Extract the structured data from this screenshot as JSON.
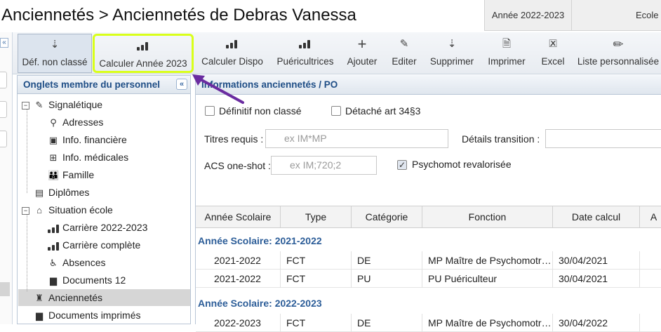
{
  "header": {
    "title": "Anciennetés > Anciennetés de Debras Vanessa",
    "year_tab": "Année 2022-2023",
    "school_tab": "Ecole"
  },
  "toolbar": {
    "buttons": [
      {
        "label": "Déf. non classé",
        "icon": "sort-icon"
      },
      {
        "label": "Calculer Année 2023",
        "icon": "bar-chart-icon"
      },
      {
        "label": "Calculer Dispo",
        "icon": "bar-chart-icon"
      },
      {
        "label": "Puéricultrices",
        "icon": "bar-chart-icon"
      },
      {
        "label": "Ajouter",
        "icon": "plus-icon"
      },
      {
        "label": "Editer",
        "icon": "edit-icon"
      },
      {
        "label": "Supprimer",
        "icon": "sort-icon"
      },
      {
        "label": "Imprimer",
        "icon": "document-icon"
      },
      {
        "label": "Excel",
        "icon": "excel-icon"
      },
      {
        "label": "Liste personnalisée",
        "icon": "pencil-icon"
      }
    ]
  },
  "sidebar": {
    "title": "Onglets membre du personnel",
    "items": [
      {
        "label": "Signalétique",
        "icon": "edit-icon",
        "expander": "−"
      },
      {
        "label": "Adresses",
        "icon": "location-icon"
      },
      {
        "label": "Info. financière",
        "icon": "money-icon"
      },
      {
        "label": "Info. médicales",
        "icon": "medical-icon"
      },
      {
        "label": "Famille",
        "icon": "family-icon"
      },
      {
        "label": "Diplômes",
        "icon": "diploma-icon"
      },
      {
        "label": "Situation école",
        "icon": "school-icon",
        "expander": "−"
      },
      {
        "label": "Carrière 2022-2023",
        "icon": "bar-chart-icon"
      },
      {
        "label": "Carrière complète",
        "icon": "bar-chart-icon"
      },
      {
        "label": "Absences",
        "icon": "absence-icon"
      },
      {
        "label": "Documents 12",
        "icon": "document-icon"
      },
      {
        "label": "Anciennetés",
        "icon": "seniority-icon"
      },
      {
        "label": "Documents imprimés",
        "icon": "document-icon"
      }
    ]
  },
  "main": {
    "section_title": "Informations anciennetés / PO",
    "checkbox_definitif": "Définitif non classé",
    "checkbox_detache": "Détaché art 34§3",
    "titres_label": "Titres requis :",
    "titres_placeholder": "ex IM*MP",
    "details_label": "Détails transition :",
    "acs_label": "ACS one-shot :",
    "acs_placeholder": "ex IM;720;2",
    "checkbox_psychomot": "Psychomot revalorisée",
    "checkmark": "✓"
  },
  "grid": {
    "columns": [
      "Année Scolaire",
      "Type",
      "Catégorie",
      "Fonction",
      "Date calcul",
      "A"
    ],
    "groups": [
      {
        "label": "Année Scolaire: 2021-2022",
        "rows": [
          [
            "2021-2022",
            "FCT",
            "DE",
            "MP Maître de Psychomotri…",
            "30/04/2021"
          ],
          [
            "2021-2022",
            "FCT",
            "PU",
            "PU Puériculteur",
            "30/04/2021"
          ]
        ]
      },
      {
        "label": "Année Scolaire: 2022-2023",
        "rows": [
          [
            "2022-2023",
            "FCT",
            "DE",
            "MP Maître de Psychomotri…",
            "30/04/2022"
          ]
        ]
      }
    ]
  },
  "colors": {
    "highlight": "#d9ff1a",
    "arrow": "#6a2ca0",
    "header_text": "#1f4e86",
    "group_text": "#2c5d98"
  }
}
